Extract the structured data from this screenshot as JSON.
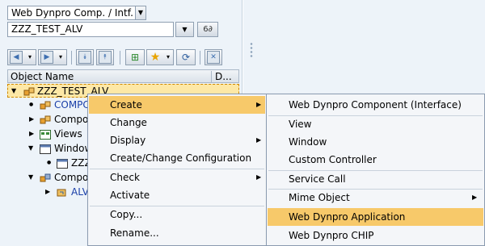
{
  "object_type_selector": {
    "value": "Web Dynpro Comp. / Intf."
  },
  "object_name_input": {
    "value": "ZZZ_TEST_ALV"
  },
  "tree": {
    "headers": {
      "name": "Object Name",
      "description": "D..."
    },
    "rows": [
      {
        "label": "ZZZ_TEST_ALV"
      },
      {
        "label": "COMPC"
      },
      {
        "label": "Compon"
      },
      {
        "label": "Views"
      },
      {
        "label": "Window"
      },
      {
        "label": "ZZZ"
      },
      {
        "label": "Compon"
      },
      {
        "label": "ALV"
      }
    ]
  },
  "context_menu": {
    "items": [
      {
        "label": "Create",
        "highlighted": true,
        "submenu": true
      },
      {
        "label": "Change"
      },
      {
        "label": "Display",
        "submenu": true
      },
      {
        "label": "Create/Change Configuration"
      },
      {
        "label": "Check",
        "submenu": true
      },
      {
        "label": "Activate"
      },
      {
        "label": "Copy..."
      },
      {
        "label": "Rename..."
      }
    ]
  },
  "create_submenu": {
    "items": [
      {
        "label": "Web Dynpro Component (Interface)"
      },
      {
        "label": "View"
      },
      {
        "label": "Window"
      },
      {
        "label": "Custom Controller"
      },
      {
        "label": "Service Call"
      },
      {
        "label": "Mime Object",
        "submenu": true
      },
      {
        "label": "Web Dynpro Application",
        "highlighted": true
      },
      {
        "label": "Web Dynpro CHIP"
      }
    ]
  },
  "colors": {
    "panel_bg": "#edf3f9",
    "highlight": "#f7c96a",
    "selection": "#fde8a6",
    "link_blue": "#1a3fa8"
  }
}
